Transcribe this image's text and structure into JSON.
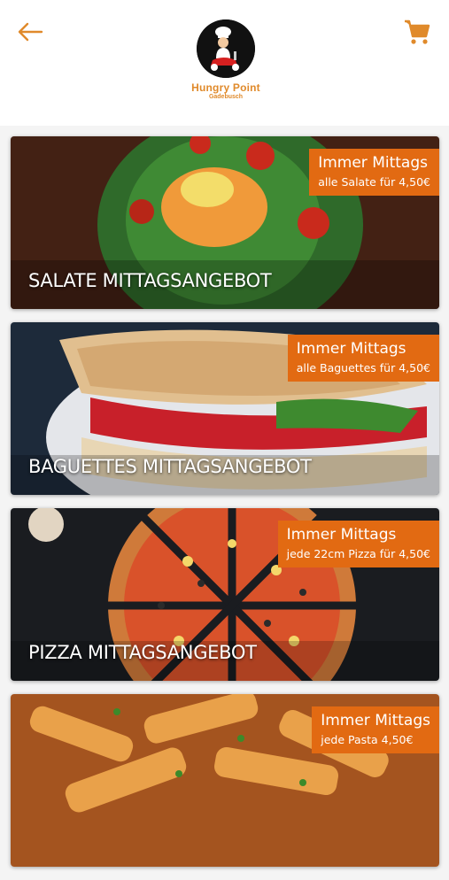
{
  "header": {
    "back_icon": "arrow-left-icon",
    "cart_icon": "shopping-cart-icon",
    "brand_name": "Hungry Point",
    "brand_location": "Gadebusch",
    "accent_color": "#e08a2b"
  },
  "offers": [
    {
      "title": "SALATE MITTAGSANGEBOT",
      "badge_title": "Immer Mittags",
      "badge_sub": "alle Salate für 4,50€"
    },
    {
      "title": "BAGUETTES MITTAGSANGEBOT",
      "badge_title": "Immer Mittags",
      "badge_sub": "alle Baguettes für 4,50€"
    },
    {
      "title": "PIZZA MITTAGSANGEBOT",
      "badge_title": "Immer Mittags",
      "badge_sub": "jede 22cm Pizza für 4,50€"
    },
    {
      "title": "",
      "badge_title": "Immer Mittags",
      "badge_sub": "jede Pasta 4,50€"
    }
  ],
  "badge_color": "#e26a12"
}
